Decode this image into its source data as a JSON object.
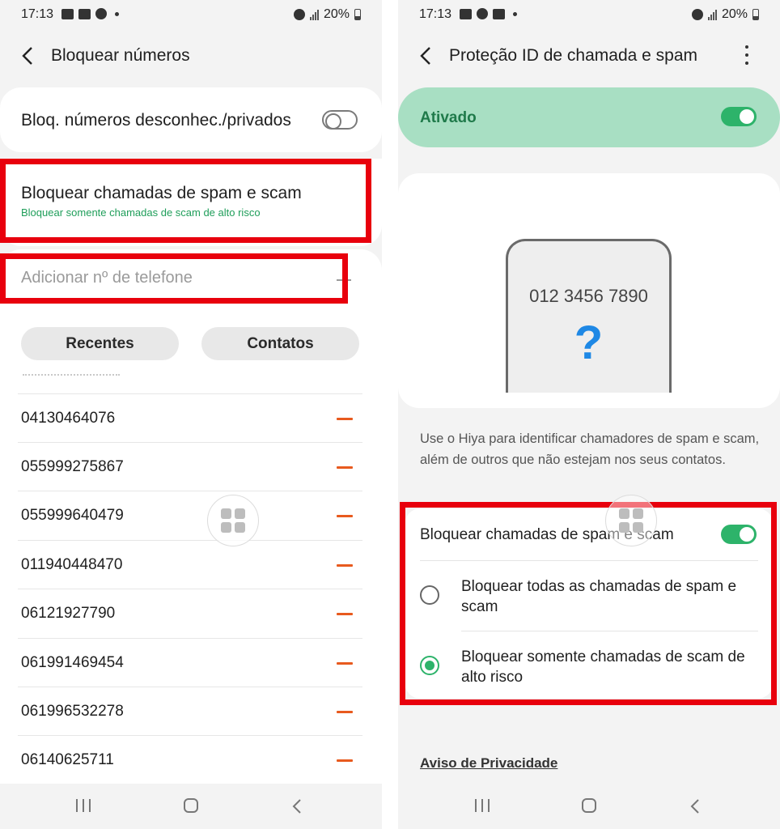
{
  "left": {
    "status": {
      "time": "17:13",
      "battery": "20%"
    },
    "title": "Bloquear números",
    "unknown_row": {
      "label": "Bloq. números desconhec./privados",
      "toggle_on": false
    },
    "spam_row": {
      "title": "Bloquear chamadas de spam e scam",
      "subtitle": "Bloquear somente chamadas de scam de alto risco"
    },
    "phone_input": {
      "placeholder": "Adicionar nº de telefone",
      "value": ""
    },
    "buttons": {
      "recents": "Recentes",
      "contacts": "Contatos"
    },
    "numbers": [
      "04130464076",
      "055999275867",
      "055999640479",
      "011940448470",
      "06121927790",
      "061991469454",
      "061996532278",
      "06140625711"
    ],
    "colors": {
      "accent_orange": "#e85a1e",
      "highlight": "#e8000d",
      "subtitle_green": "#1f9e5a"
    }
  },
  "right": {
    "status": {
      "time": "17:13",
      "battery": "20%"
    },
    "title": "Proteção ID de chamada e spam",
    "activated": {
      "label": "Ativado",
      "toggle_on": true
    },
    "phone_illustration": {
      "number": "012 3456 7890",
      "symbol": "?"
    },
    "description": "Use o Hiya para identificar chamadores de spam e scam, além de outros que não estejam nos seus contatos.",
    "block_toggle": {
      "label": "Bloquear chamadas de spam e scam",
      "toggle_on": true
    },
    "options": [
      {
        "label": "Bloquear todas as chamadas de spam e scam",
        "selected": false
      },
      {
        "label": "Bloquear somente chamadas de scam de alto risco",
        "selected": true
      }
    ],
    "privacy_link": "Aviso de Privacidade",
    "colors": {
      "activated_bg": "#a8dfc3",
      "activated_text": "#1f7a4a",
      "toggle_green": "#2db36a",
      "question_blue": "#1e88e5"
    }
  }
}
